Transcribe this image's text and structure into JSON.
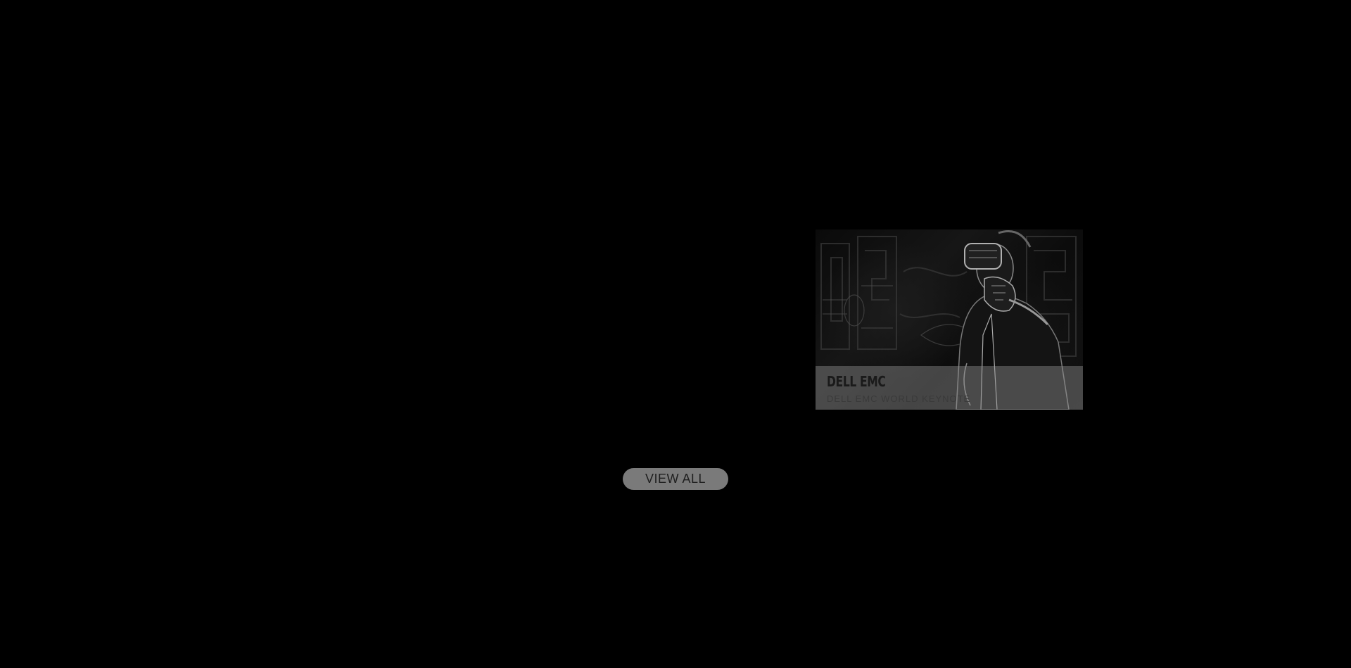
{
  "card": {
    "title": "DELL EMC",
    "subtitle": "DELL EMC WORLD KEYNOTE"
  },
  "view_all": {
    "label": "VIEW ALL"
  },
  "colors": {
    "background": "#000000",
    "caption_overlay": "#969696",
    "button_bg": "#7a7a7a",
    "title_text": "#1a1a1a"
  }
}
